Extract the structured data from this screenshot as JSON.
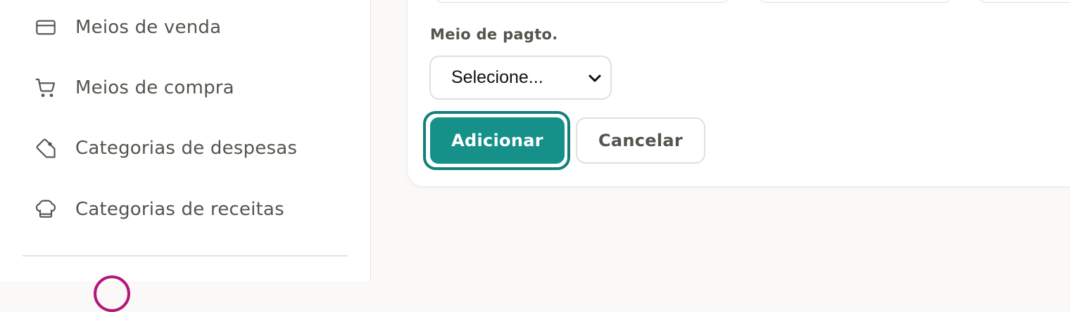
{
  "sidebar": {
    "items": [
      {
        "label": "Meios de venda",
        "icon": "credit-card-icon"
      },
      {
        "label": "Meios de compra",
        "icon": "shopping-cart-icon"
      },
      {
        "label": "Categorias de despesas",
        "icon": "tag-icon"
      },
      {
        "label": "Categorias de receitas",
        "icon": "chef-hat-icon"
      }
    ]
  },
  "form": {
    "payment_label": "Meio de pagto.",
    "payment_select_value": "Selecione...",
    "add_button": "Adicionar",
    "cancel_button": "Cancelar"
  },
  "colors": {
    "primary": "#15918a",
    "primary_ring": "#14807a",
    "text": "#57534e",
    "avatar_ring": "#b3177a"
  }
}
